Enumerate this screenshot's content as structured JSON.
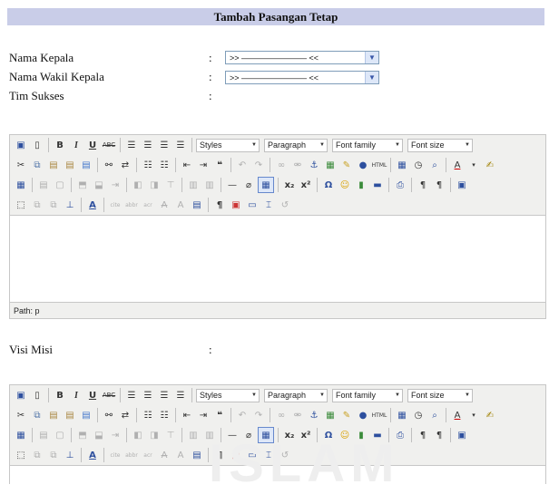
{
  "header": {
    "title": "Tambah Pasangan Tetap"
  },
  "form": {
    "colon": ":",
    "fields": [
      {
        "label": "Nama Kepala",
        "value": ">> ———————— <<"
      },
      {
        "label": "Nama Wakil Kepala",
        "value": ">> ———————— <<"
      },
      {
        "label": "Tim Sukses"
      },
      {
        "label": "Visi Misi"
      }
    ]
  },
  "editor": {
    "dropdowns": [
      "Styles",
      "Paragraph",
      "Font family",
      "Font size"
    ],
    "path_label": "Path: p",
    "icons_row1": [
      "save-icon",
      "new-document-icon",
      "bold-icon",
      "italic-icon",
      "underline-icon",
      "strikethrough-icon",
      "align-left-icon",
      "align-center-icon",
      "align-right-icon",
      "align-justify-icon"
    ],
    "icons_row2": [
      "cut-icon",
      "copy-icon",
      "paste-icon",
      "paste-text-icon",
      "paste-word-icon",
      "find-icon",
      "replace-icon",
      "bullet-list-icon",
      "numbered-list-icon",
      "outdent-icon",
      "indent-icon",
      "blockquote-icon",
      "undo-icon",
      "redo-icon",
      "link-icon",
      "unlink-icon",
      "anchor-icon",
      "image-icon",
      "cleanup-icon",
      "help-icon",
      "html-icon",
      "insert-date-icon",
      "insert-time-icon",
      "preview-icon",
      "text-color-icon",
      "highlight-color-icon"
    ],
    "icons_row3": [
      "table-icon",
      "table-row-props-icon",
      "table-cell-props-icon",
      "insert-row-before-icon",
      "insert-row-after-icon",
      "delete-row-icon",
      "insert-col-before-icon",
      "insert-col-after-icon",
      "delete-col-icon",
      "split-cells-icon",
      "merge-cells-icon",
      "horizontal-rule-icon",
      "remove-format-icon",
      "visual-aid-icon",
      "subscript-icon",
      "superscript-icon",
      "special-char-icon",
      "emoticon-icon",
      "media-icon",
      "advanced-hr-icon",
      "print-icon",
      "ltr-icon",
      "rtl-icon",
      "fullscreen-icon"
    ],
    "icons_row4": [
      "insert-layer-icon",
      "move-forward-icon",
      "move-backward-icon",
      "absolute-icon",
      "style-props-icon",
      "citation-icon",
      "abbreviation-icon",
      "acronym-icon",
      "deletion-icon",
      "insertion-icon",
      "attributes-icon",
      "show-blocks-icon",
      "template-icon",
      "non-breaking-icon",
      "page-break-icon",
      "restore-draft-icon"
    ]
  },
  "watermark": {
    "text": "ISLAM"
  },
  "colors": {
    "header_bg": "#c9cde8",
    "toolbar_bg": "#f0f0ee",
    "select_border": "#7f9db9"
  }
}
